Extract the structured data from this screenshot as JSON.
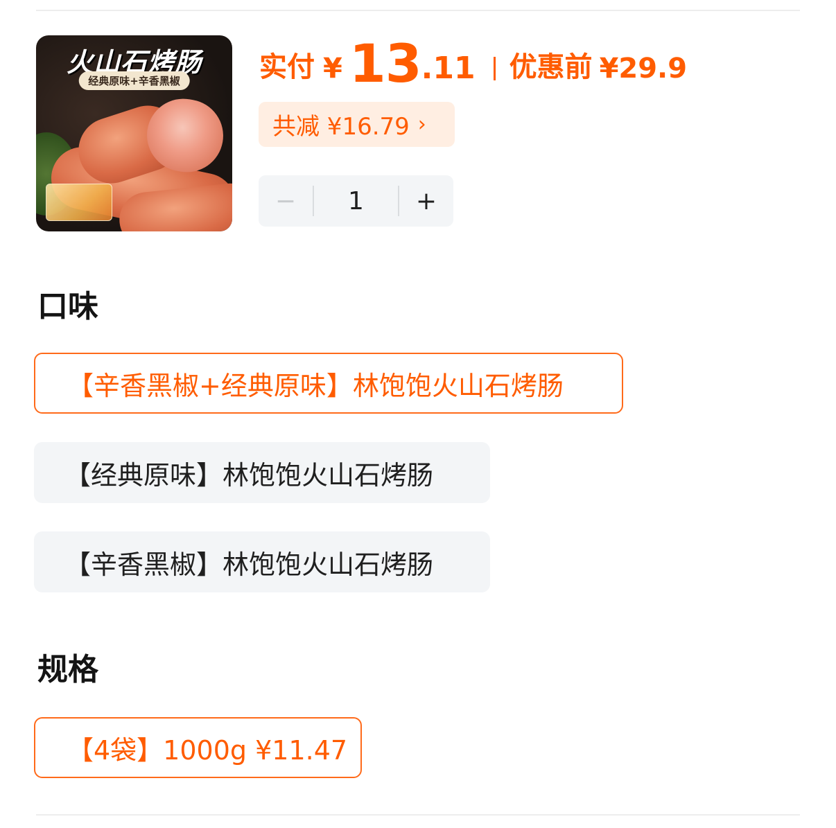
{
  "product": {
    "image": {
      "title": "火山石烤肠",
      "subtitle": "经典原味+辛香黑椒"
    },
    "price": {
      "label": "实付",
      "currency": "¥",
      "integer": "13",
      "decimal": ".11",
      "original_label": "优惠前",
      "original_value": "¥29.9"
    },
    "discount": {
      "label": "共减 ¥16.79",
      "chevron": "›"
    },
    "quantity": {
      "minus": "−",
      "value": "1",
      "plus": "+"
    }
  },
  "flavor": {
    "title": "口味",
    "options": [
      {
        "label": "【辛香黑椒+经典原味】林饱饱火山石烤肠",
        "selected": true
      },
      {
        "label": "【经典原味】林饱饱火山石烤肠",
        "selected": false
      },
      {
        "label": "【辛香黑椒】林饱饱火山石烤肠",
        "selected": false
      }
    ]
  },
  "spec": {
    "title": "规格",
    "options": [
      {
        "label": "【4袋】1000g ¥11.47",
        "selected": true
      }
    ]
  },
  "colors": {
    "accent": "#ff5c00",
    "pill_bg": "#ffeee2",
    "unselected_bg": "#f3f5f7"
  }
}
